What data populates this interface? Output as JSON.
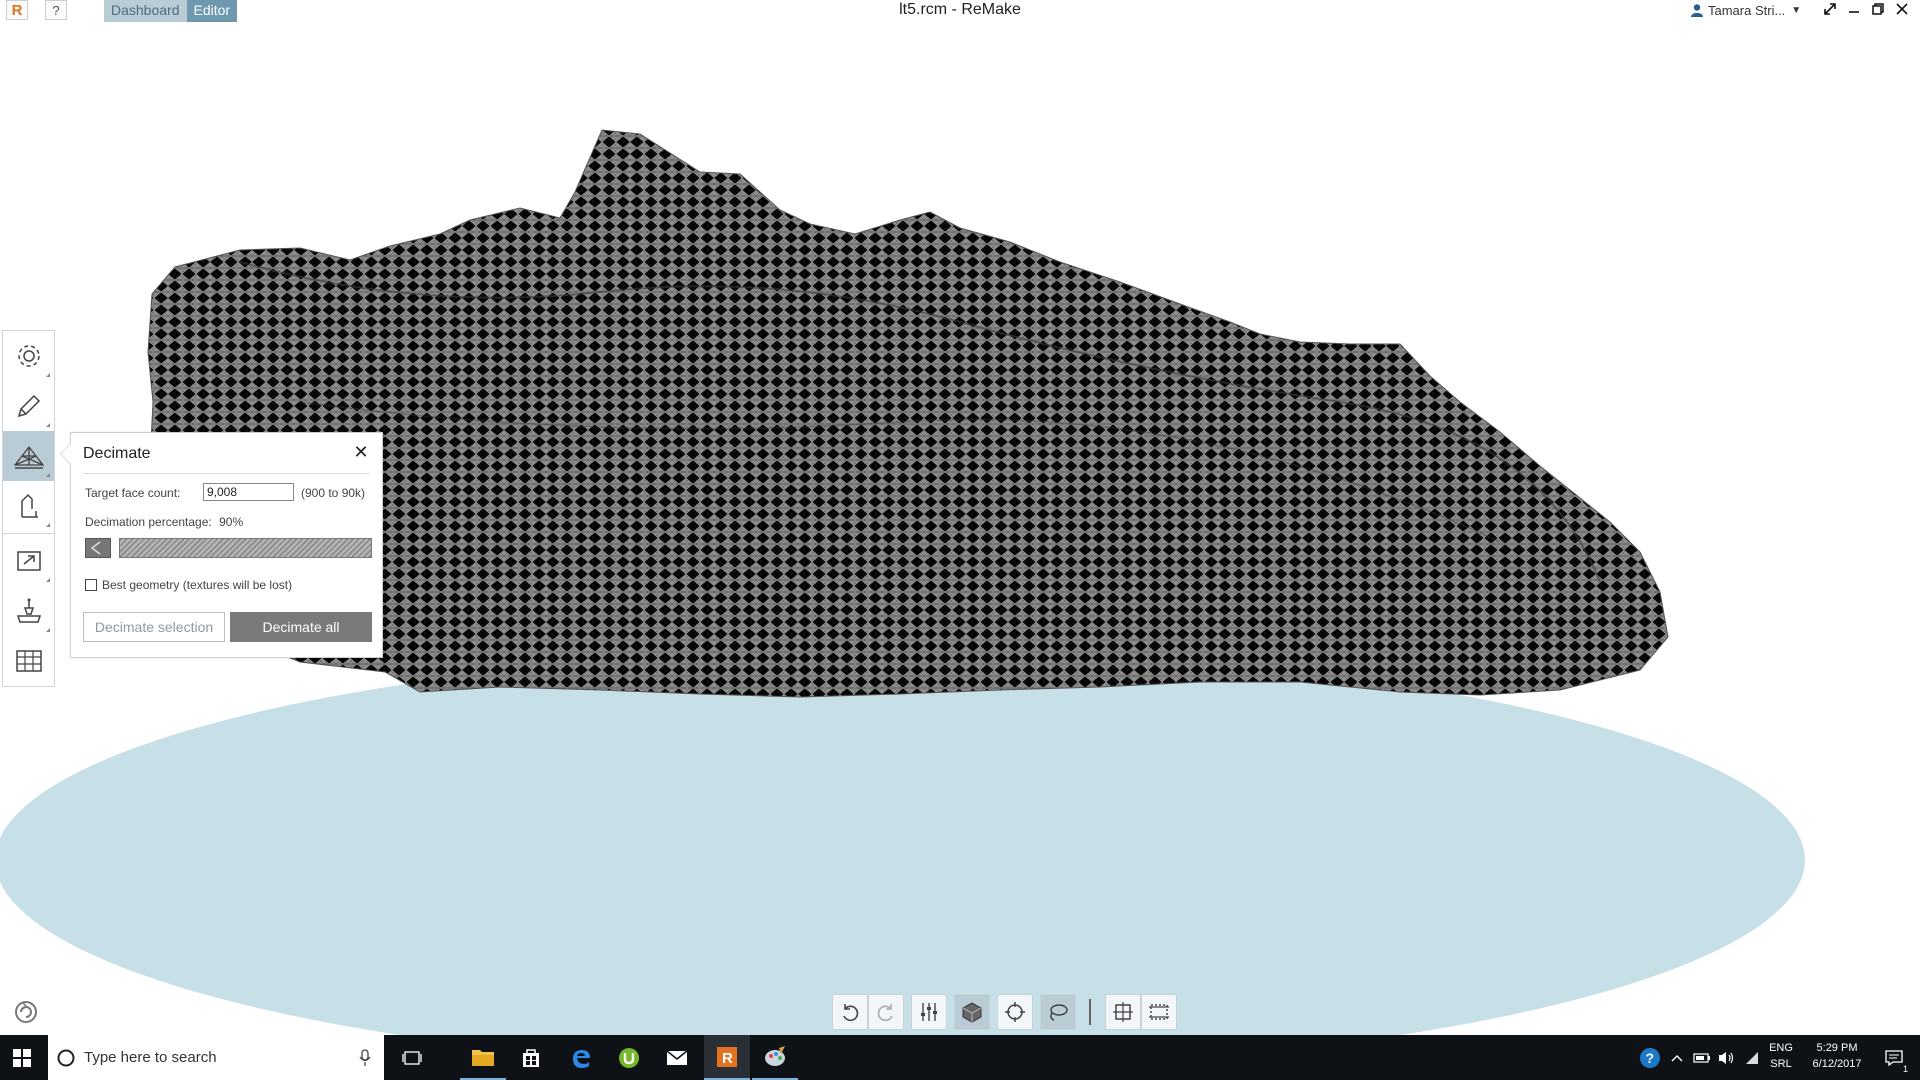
{
  "app": {
    "logo_letter": "R",
    "help_label": "?",
    "tabs": [
      "Dashboard",
      "Editor"
    ],
    "window_title": "lt5.rcm - ReMake",
    "user_name": "Tamara Stri...",
    "window_controls": [
      "expand-icon",
      "minimize-icon",
      "restore-icon",
      "close-icon"
    ]
  },
  "left_toolbar": {
    "items": [
      "settings-icon",
      "pencil-icon",
      "mesh-icon",
      "measure-icon",
      "export-icon",
      "print-icon",
      "table-icon"
    ],
    "active": "mesh-icon"
  },
  "decimate_panel": {
    "title": "Decimate",
    "close": "✕",
    "target_label": "Target face count:",
    "target_value": "9,008",
    "target_range": "(900 to 90k)",
    "percentage_label": "Decimation percentage:",
    "percentage_value": "90%",
    "best_geometry_label": "Best geometry (textures will be lost)",
    "best_geometry_checked": false,
    "btn_selection": "Decimate selection",
    "btn_all": "Decimate all"
  },
  "bottom_toolbar": {
    "items": [
      "undo-icon",
      "redo-icon",
      "adjust-icon",
      "cube-icon",
      "target-icon",
      "lasso-icon",
      "frame-icon",
      "select-rect-icon"
    ],
    "active": [
      "cube-icon",
      "lasso-icon"
    ]
  },
  "taskbar": {
    "search_placeholder": "Type here to search",
    "lang_top": "ENG",
    "lang_bottom": "SRL",
    "time": "5:29 PM",
    "date": "6/12/2017",
    "notification_count": "1"
  },
  "colors": {
    "accent": "#6e98ad",
    "accent_light": "#b9cbd5",
    "ground": "#c7dfe6",
    "mesh": "#6f6f6f",
    "taskbar": "#0e1216"
  }
}
